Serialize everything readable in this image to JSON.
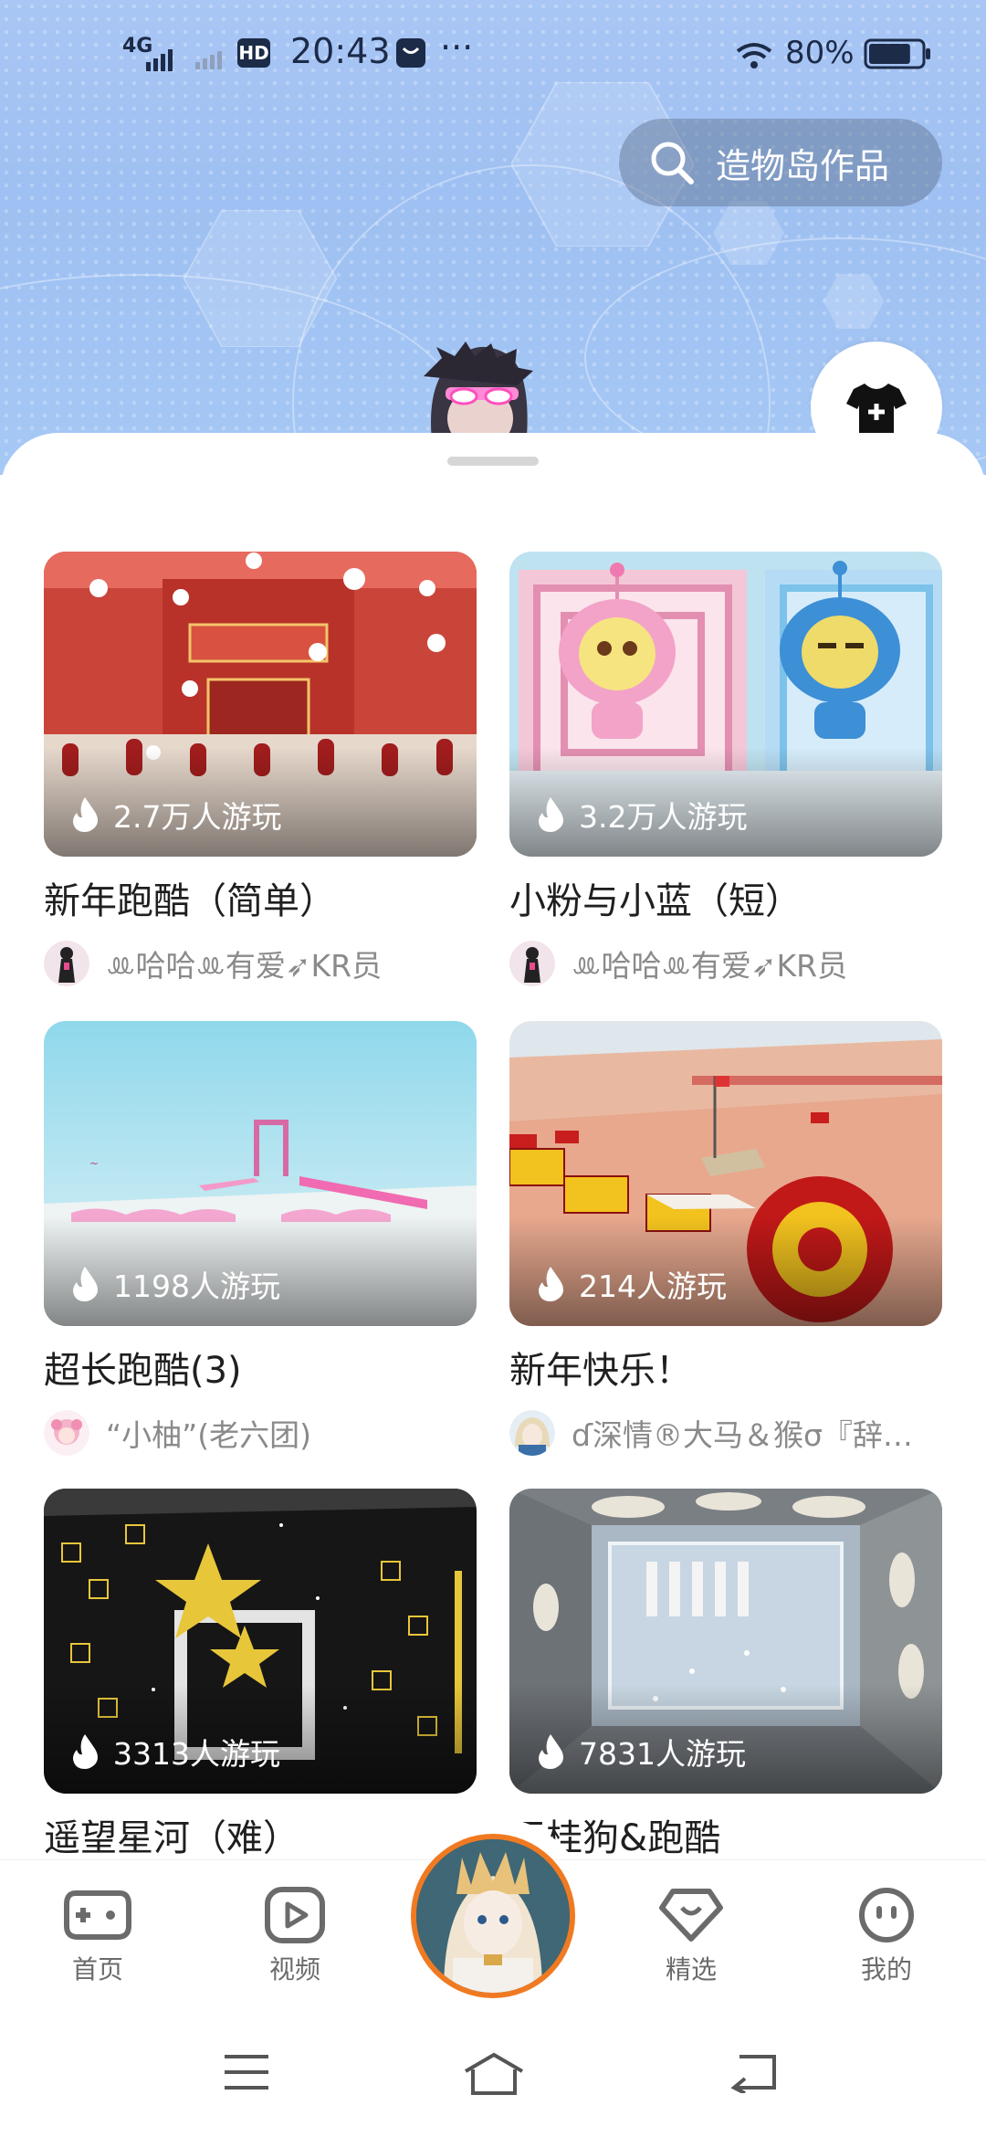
{
  "status_bar": {
    "network": "4G",
    "hd": "HD",
    "time": "20:43",
    "more": "···",
    "battery_percent": "80%",
    "battery_level": 0.8
  },
  "search": {
    "label": "造物岛作品",
    "icon": "search-icon"
  },
  "wardrobe": {
    "icon": "tshirt-plus-icon"
  },
  "cards": [
    {
      "title": "新年跑酷（简单）",
      "plays": "2.7万人游玩",
      "author": "ꔛ哈哈ꔛ有爱➶KR员"
    },
    {
      "title": "小粉与小蓝（短）",
      "plays": "3.2万人游玩",
      "author": "ꔛ哈哈ꔛ有爱➶KR员"
    },
    {
      "title": "超长跑酷(3)",
      "plays": "1198人游玩",
      "author": "“小柚”(老六团)"
    },
    {
      "title": "新年快乐！",
      "plays": "214人游玩",
      "author": "ɗ深情®大马＆猴σ『辞…"
    },
    {
      "title": "遥望星河（难）",
      "plays": "3313人游玩",
      "author": ""
    },
    {
      "title": "王桂狗&跑酷",
      "plays": "7831人游玩",
      "author": ""
    }
  ],
  "nav": {
    "items": [
      {
        "label": "首页",
        "icon": "gamepad-icon"
      },
      {
        "label": "视频",
        "icon": "video-play-icon"
      },
      {
        "label": "精选",
        "icon": "heart-gem-icon"
      },
      {
        "label": "我的",
        "icon": "smiley-face-icon"
      }
    ],
    "accent_color": "#f07a22"
  },
  "system_nav": {
    "icons": [
      "menu-icon",
      "home-icon",
      "back-icon"
    ]
  }
}
